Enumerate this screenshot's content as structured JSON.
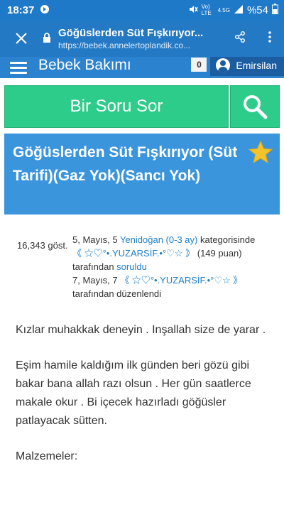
{
  "status": {
    "time": "18:37",
    "network": "Vo) LTE",
    "signal_label": "4.5G",
    "battery": "%54",
    "icons": [
      "data-saver-icon",
      "mute-icon",
      "wifi-icon",
      "signal-icon",
      "battery-icon"
    ]
  },
  "browser": {
    "page_title": "Göğüslerden Süt Fışkırıyor...",
    "url": "https://bebek.annelertoplandik.co..."
  },
  "site": {
    "brand": "Bebek Bakımı",
    "notification_count": "0",
    "username": "Emirsilan"
  },
  "ask": {
    "label": "Bir Soru Sor"
  },
  "question": {
    "title": "Göğüslerden Süt Fışkırıyor (Süt Tarifi)(Gaz Yok)(Sancı Yok)"
  },
  "meta": {
    "views": "16,343 göst.",
    "asked_date": "5, Mayıs, 5",
    "category": "Yenidoğan (0-3 ay)",
    "category_suffix": "kategorisinde",
    "asker": "《 ☆♡°•.YUZARSİF.•°♡☆ 》",
    "points": "(149 puan)",
    "by_label": "tarafından",
    "asked_label": "soruldu",
    "edited_date": "7, Mayıs, 7",
    "editor": "《 ☆♡°•.YUZARSİF.•°♡☆ 》",
    "edited_label": "tarafından düzenlendi"
  },
  "body": {
    "paragraphs": [
      "Kızlar muhakkak deneyin . Inşallah size de yarar .",
      "Eşim hamile kaldığım ilk günden beri gözü gibi bakar bana allah razı olsun . Her gün saatlerce makale okur . Bi içecek hazırladı göğüsler patlayacak sütten.",
      "Malzemeler:"
    ]
  },
  "colors": {
    "chrome_blue": "#2479c5",
    "ask_green": "#2ecc8a",
    "title_blue": "#3a95dd",
    "link_blue": "#1f7fc9",
    "star_yellow": "#f4c22b"
  }
}
